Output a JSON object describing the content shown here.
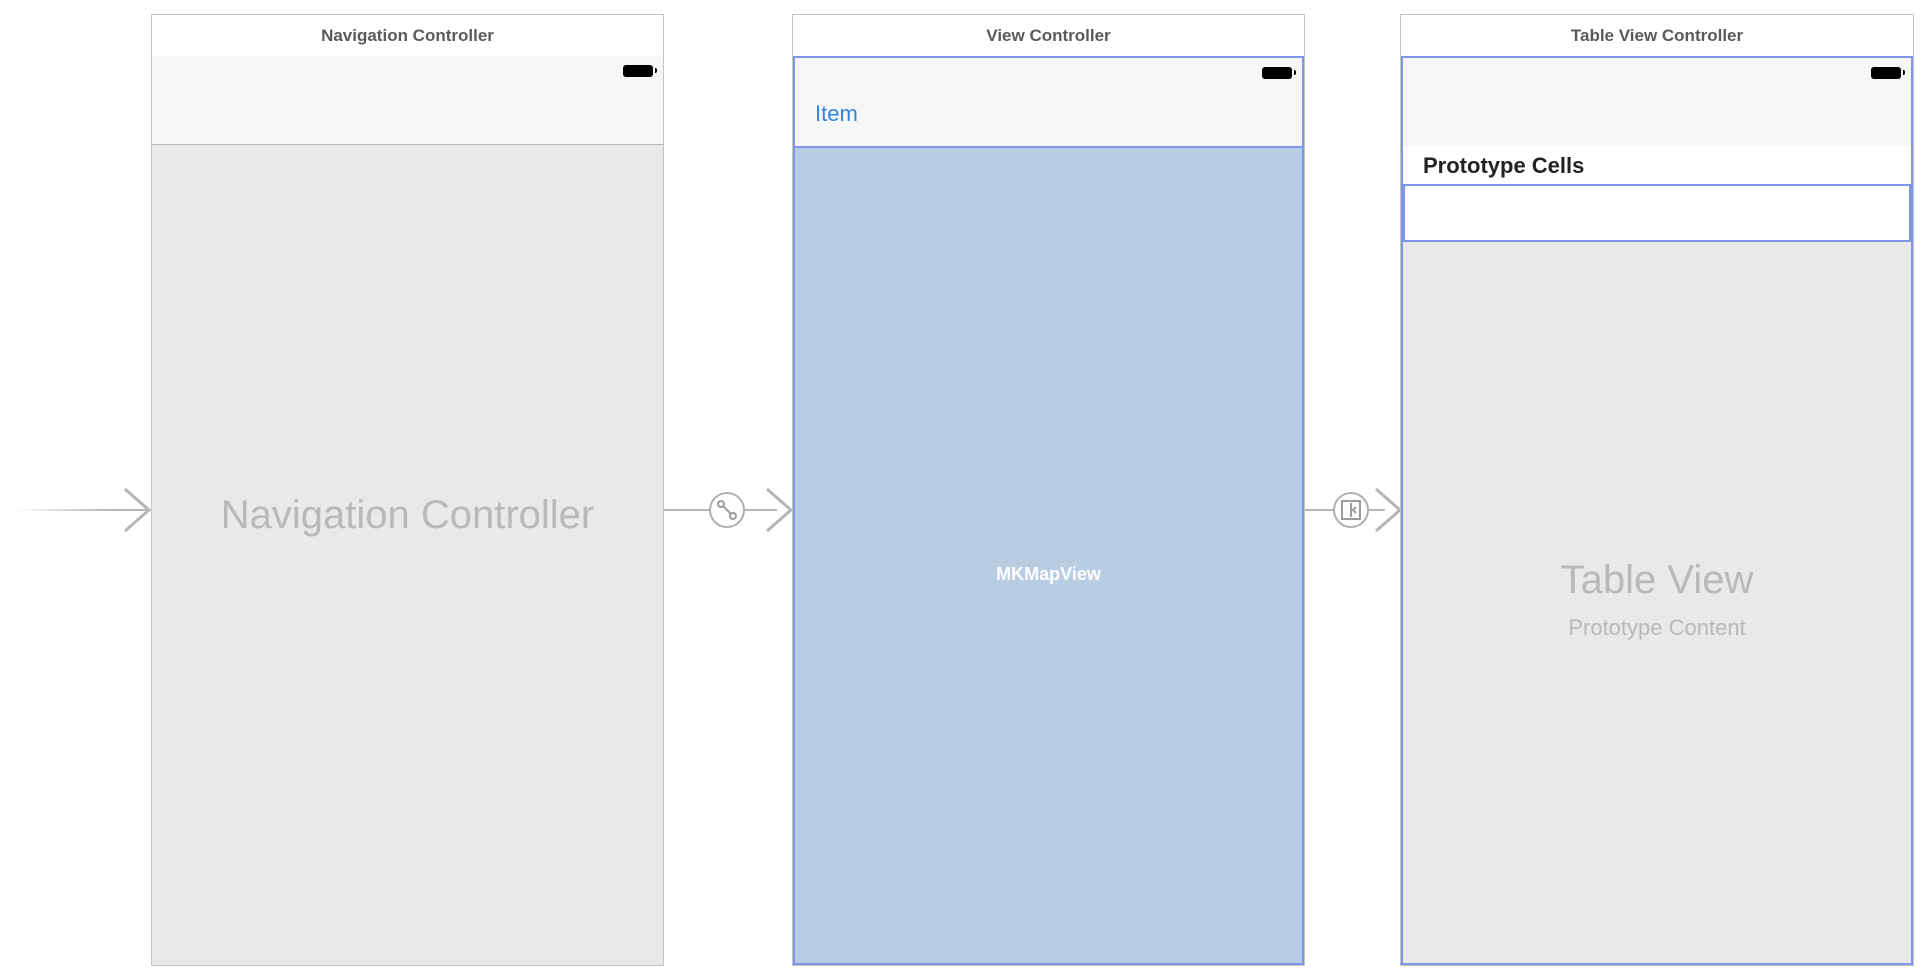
{
  "scenes": {
    "navigation": {
      "title": "Navigation Controller",
      "placeholder": "Navigation Controller"
    },
    "view": {
      "title": "View Controller",
      "nav_item": "Item",
      "map_label": "MKMapView"
    },
    "table": {
      "title": "Table View Controller",
      "section_header": "Prototype Cells",
      "placeholder_title": "Table View",
      "placeholder_subtitle": "Prototype Content"
    }
  },
  "segues": {
    "entry": {
      "icon": "entry-arrow-icon"
    },
    "root_relationship": {
      "icon": "relationship-segue-icon"
    },
    "show": {
      "icon": "show-segue-icon"
    }
  },
  "colors": {
    "selection": "#7f95e8",
    "map_fill": "#b8cce4",
    "tint": "#2e86e0"
  }
}
